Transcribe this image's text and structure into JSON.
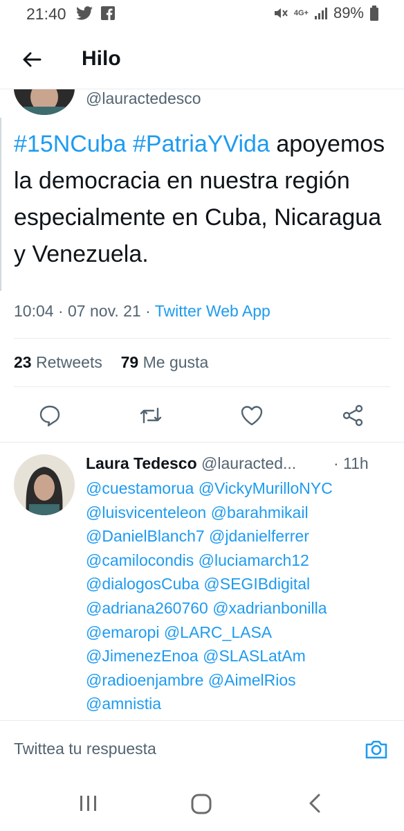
{
  "status_bar": {
    "time": "21:40",
    "left_icons": [
      "twitter-bird-icon",
      "facebook-icon"
    ],
    "right_icons": [
      "mute-icon",
      "network-4g-icon",
      "signal-icon",
      "battery-icon"
    ],
    "network_label": "4G+",
    "battery": "89%"
  },
  "header": {
    "title": "Hilo",
    "back_icon": "arrow-left-icon"
  },
  "main_tweet": {
    "handle": "@lauractedesco",
    "hashtags": [
      "#15NCuba",
      "#PatriaYVida"
    ],
    "text": "apoyemos la democracia en nuestra región especialmente en Cuba, Nicaragua y Venezuela.",
    "time": "10:04",
    "date": "07 nov. 21",
    "separator": "·",
    "source": "Twitter Web App",
    "retweets_count": "23",
    "retweets_label": "Retweets",
    "likes_count": "79",
    "likes_label": "Me gusta",
    "actions": [
      "reply-icon",
      "retweet-icon",
      "like-icon",
      "share-icon"
    ]
  },
  "reply_tweet": {
    "name": "Laura Tedesco",
    "handle": "@lauracted...",
    "time": "· 11h",
    "mentions": [
      "@cuestamorua @VickyMurilloNYC",
      "@luisvicenteleon @barahmikail",
      "@DanielBlanch7 @jdanielferrer",
      "@camilocondis @luciamarch12",
      "@dialogosCuba @SEGIBdigital",
      "@adriana260760 @xadrianbonilla",
      "@emaropi @LARC_LASA",
      "@JimenezEnoa @SLASLatAm",
      "@radioenjambre @AimelRios",
      "@amnistia"
    ]
  },
  "compose": {
    "placeholder": "Twittea tu respuesta",
    "icon": "camera-icon"
  },
  "nav_bar": {
    "buttons": [
      "recents-icon",
      "home-icon",
      "back-icon"
    ]
  },
  "colors": {
    "link": "#1d9bf0",
    "text": "#0f1419",
    "secondary": "#536471",
    "divider": "#e6ecf0"
  }
}
